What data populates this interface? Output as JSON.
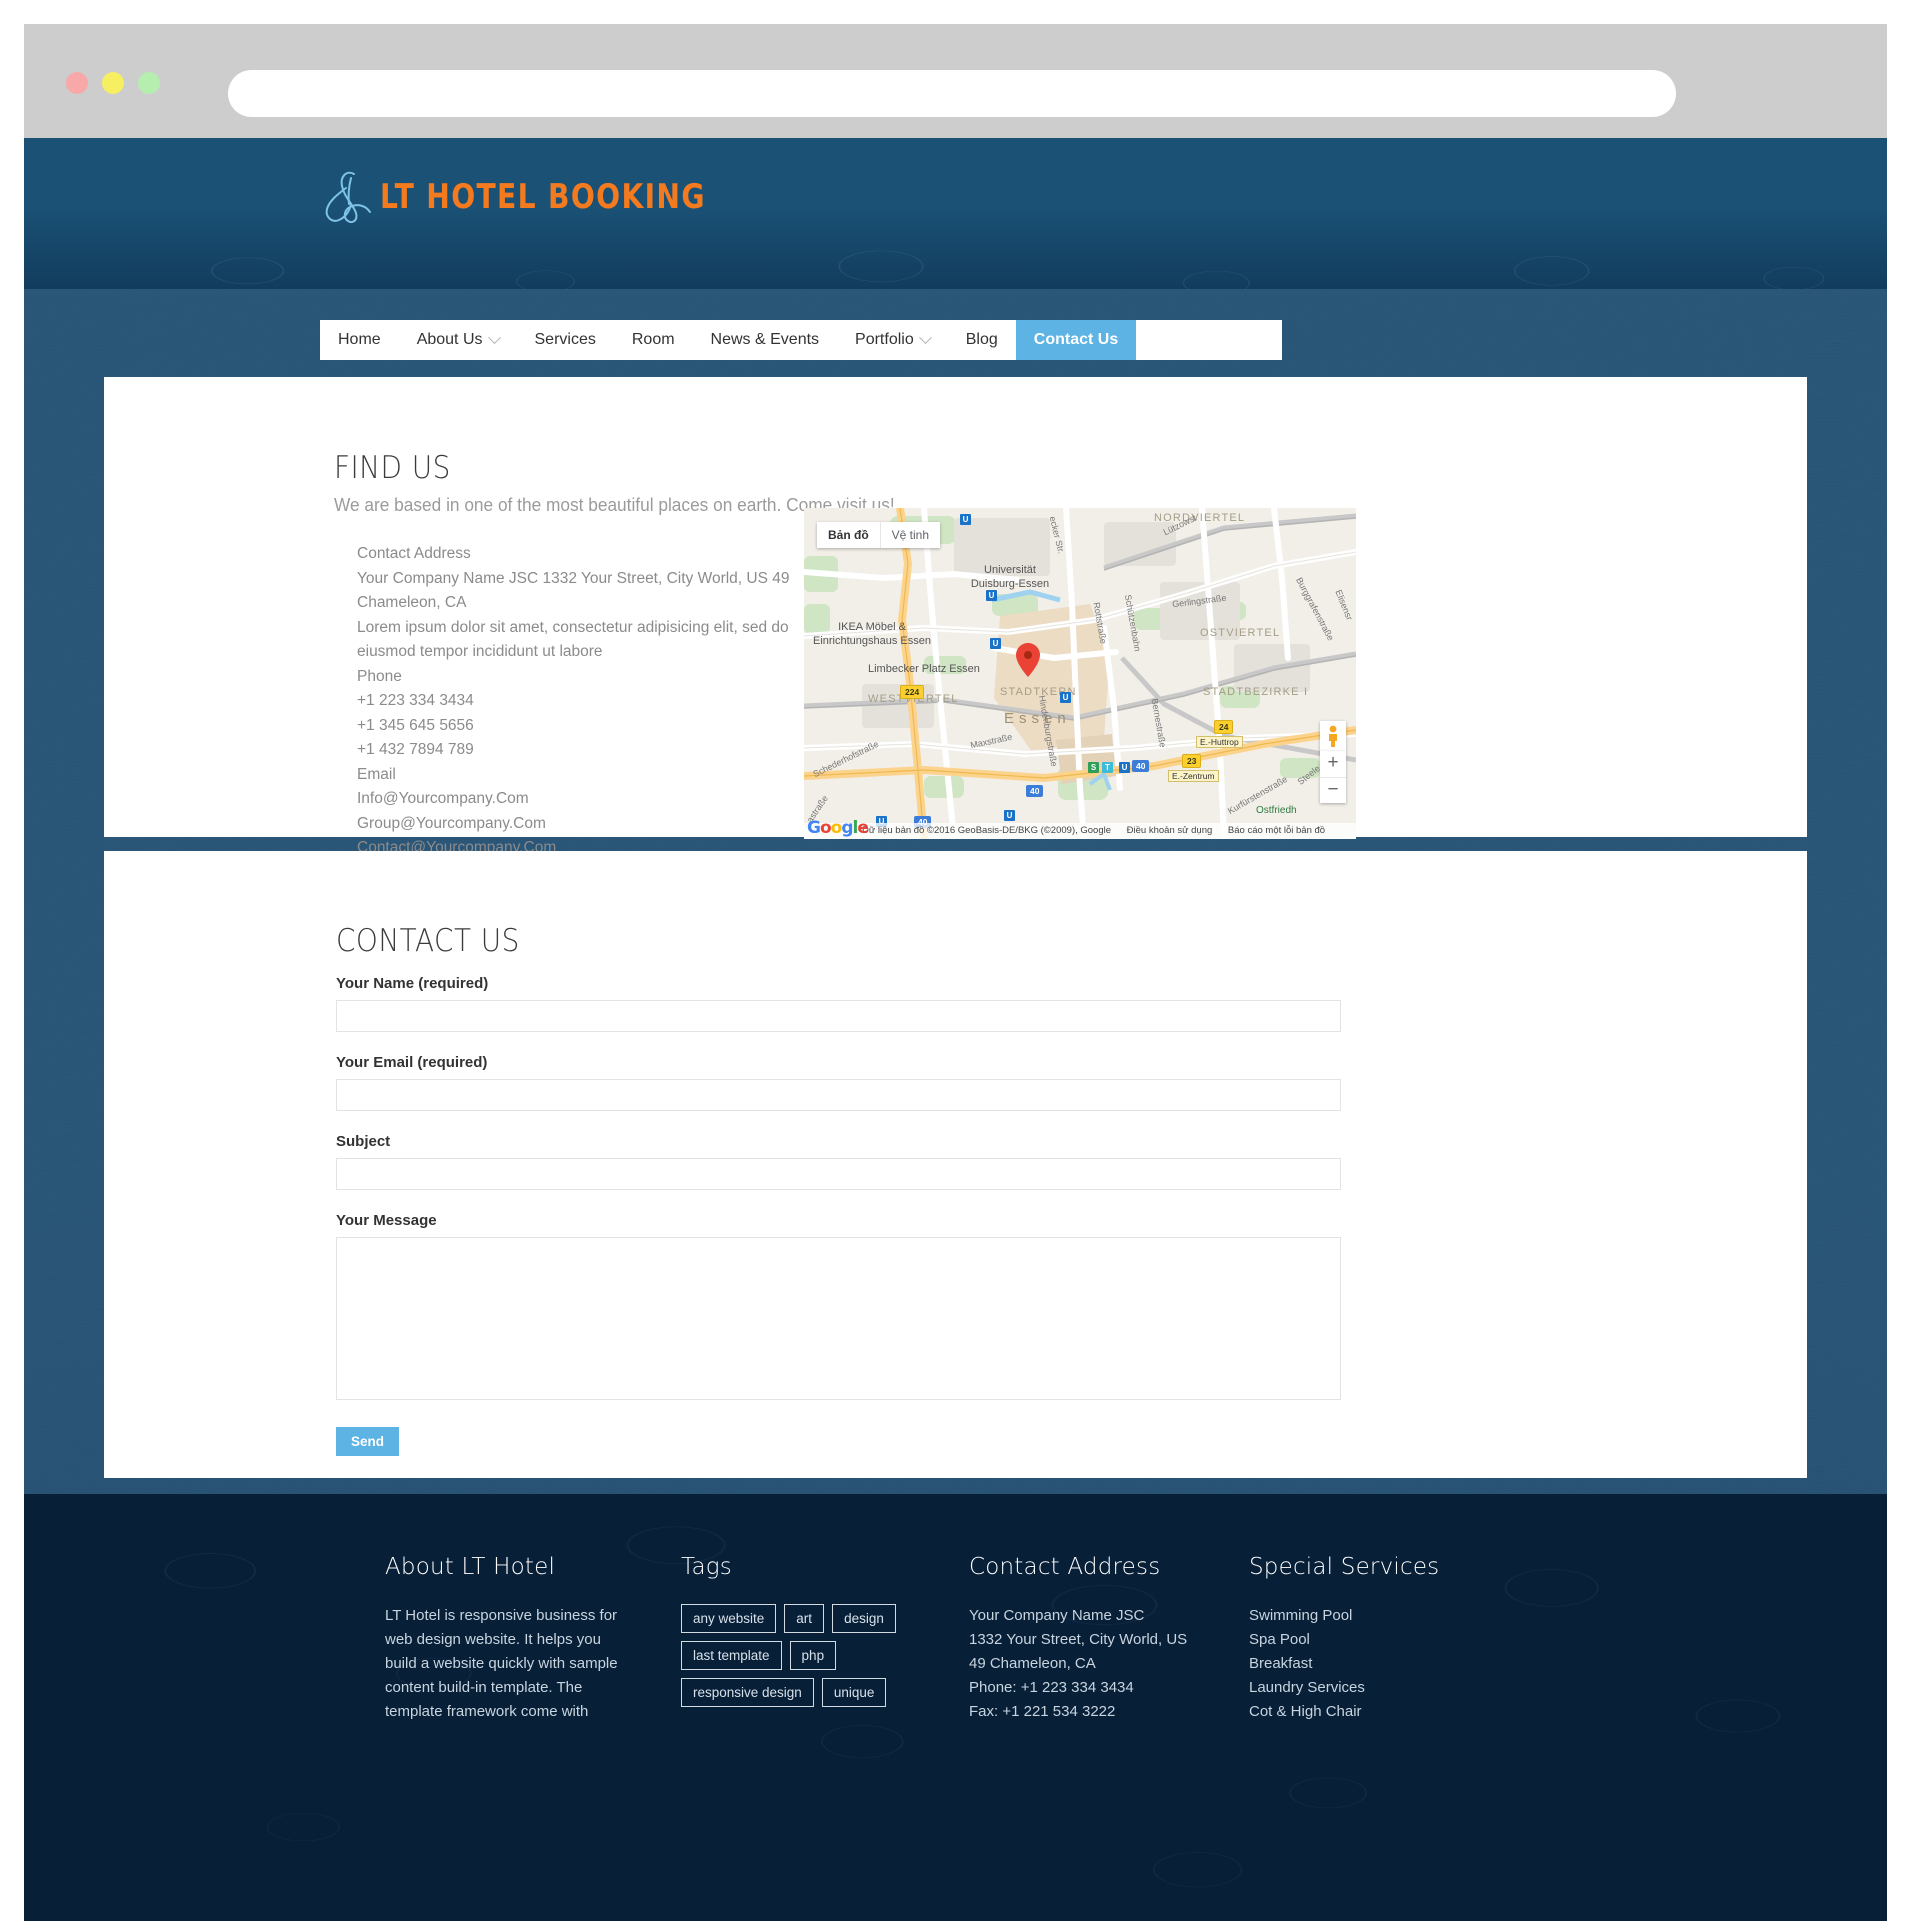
{
  "browser": {
    "address_value": "",
    "address_placeholder": "",
    "lights": [
      "close-red",
      "minimize-yellow",
      "maximize-green"
    ]
  },
  "header": {
    "brand_name": "LT HOTEL BOOKING",
    "brand_color": "#f47a20",
    "accent_color": "#5cb3e4"
  },
  "nav": {
    "items": [
      {
        "label": "Home",
        "active": false,
        "caret": false
      },
      {
        "label": "About Us",
        "active": false,
        "caret": true
      },
      {
        "label": "Services",
        "active": false,
        "caret": false
      },
      {
        "label": "Room",
        "active": false,
        "caret": false
      },
      {
        "label": "News & Events",
        "active": false,
        "caret": false
      },
      {
        "label": "Portfolio",
        "active": false,
        "caret": true
      },
      {
        "label": "Blog",
        "active": false,
        "caret": false
      },
      {
        "label": "Contact Us",
        "active": true,
        "caret": false
      }
    ]
  },
  "find_us": {
    "title": "FIND US",
    "subtitle": "We are based in one of the most beautiful places on earth. Come visit us!",
    "info": [
      "Contact Address",
      "Your Company Name JSC 1332 Your Street, City World, US 49 Chameleon, CA",
      "Lorem ipsum dolor sit amet, consectetur adipisicing elit, sed do eiusmod tempor incididunt ut labore",
      "Phone",
      "+1 223 334 3434",
      "+1 345 645 5656",
      "+1 432 7894 789",
      "Email",
      "Info@Yourcompany.Com",
      "Group@Yourcompany.Com",
      "Contact@Yourcompany.Com"
    ]
  },
  "map": {
    "type_map_label": "Bản đồ",
    "type_satellite_label": "Vệ tinh",
    "zoom_in_label": "+",
    "zoom_out_label": "−",
    "logo_letters": [
      "G",
      "o",
      "o",
      "g",
      "l",
      "e"
    ],
    "attribution": [
      "Dữ liệu bản đồ ©2016 GeoBasis-DE/BKG (©2009), Google",
      "Điều khoản sử dụng",
      "Báo cáo một lỗi bản đồ"
    ],
    "labels": {
      "districts": [
        "NORDVIERTEL",
        "OSTVIERTEL",
        "STADTBEZIRKE I",
        "WESTVIERTEL",
        "STADTKERN"
      ],
      "city": "Essen",
      "pois": [
        "Universität Duisburg-Essen",
        "IKEA Möbel & Einrichtungshaus Essen",
        "Limbecker Platz Essen"
      ],
      "streets": [
        "Lützowst",
        "Burggrafenstraße",
        "Elisensr",
        "Gerlingstraße",
        "ecker Str.",
        "Rottstraße",
        "Schützenbahn",
        "Hindenburgstraße",
        "Maxstraße",
        "Bernestraße",
        "Schederhofstraße",
        "Kurfürstenstraße",
        "Steele",
        "astraße"
      ],
      "green": "Ostfriedh",
      "exits": [
        "E.-Huttrop",
        "E.-Zentrum"
      ],
      "highway_badges": [
        "40",
        "40",
        "40",
        "224",
        "24",
        "23"
      ]
    }
  },
  "contact_form": {
    "title": "CONTACT US",
    "fields": [
      {
        "label": "Your Name (required)",
        "value": "",
        "placeholder": "",
        "type": "text"
      },
      {
        "label": "Your Email (required)",
        "value": "",
        "placeholder": "",
        "type": "text"
      },
      {
        "label": "Subject",
        "value": "",
        "placeholder": "",
        "type": "text"
      },
      {
        "label": "Your Message",
        "value": "",
        "placeholder": "",
        "type": "textarea"
      }
    ],
    "send_label": "Send",
    "send_color": "#5cb3e4"
  },
  "footer": {
    "about": {
      "title": "About LT Hotel",
      "text": "LT Hotel is responsive business for web design website. It helps you build a website quickly with sample content build-in template. The template framework come with"
    },
    "tags": {
      "title": "Tags",
      "items": [
        "any website",
        "art",
        "design",
        "last template",
        "php",
        "responsive design",
        "unique"
      ]
    },
    "address": {
      "title": "Contact Address",
      "lines": [
        "Your Company Name JSC",
        "1332 Your Street, City World, US",
        "49 Chameleon, CA",
        "Phone: +1 223 334 3434",
        "Fax: +1 221 534 3222"
      ]
    },
    "services": {
      "title": "Special Services",
      "items": [
        "Swimming Pool",
        "Spa Pool",
        "Breakfast",
        "Laundry Services",
        "Cot & High Chair"
      ]
    }
  }
}
